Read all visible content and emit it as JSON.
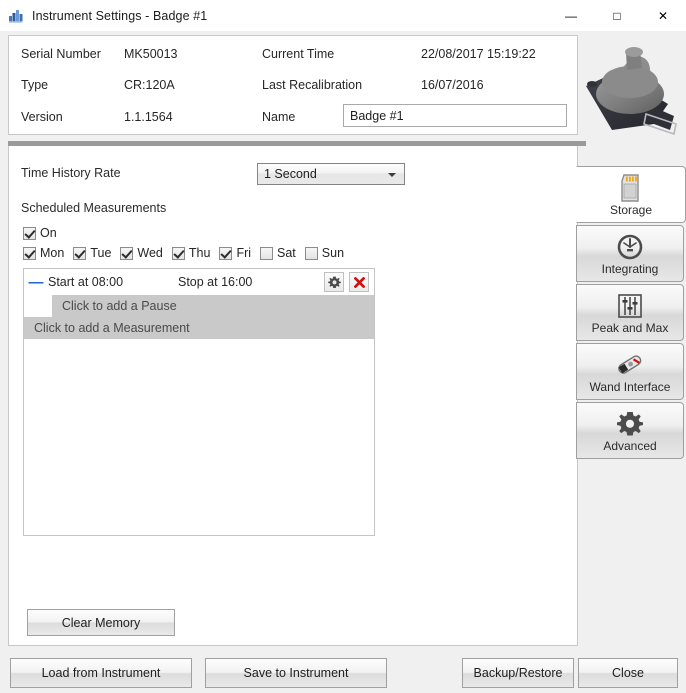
{
  "window": {
    "title": "Instrument Settings - Badge #1",
    "icon": "app-chart-icon",
    "minimize": "—",
    "maximize": "□",
    "close": "✕"
  },
  "info": {
    "serial_number_label": "Serial Number",
    "serial_number_value": "MK50013",
    "type_label": "Type",
    "type_value": "CR:120A",
    "version_label": "Version",
    "version_value": "1.1.1564",
    "current_time_label": "Current Time",
    "current_time_value": "22/08/2017 15:19:22",
    "last_recalibration_label": "Last Recalibration",
    "last_recalibration_value": "16/07/2016",
    "name_label": "Name",
    "name_value": "Badge #1",
    "name_placeholder": "Name"
  },
  "storage": {
    "time_history_rate_label": "Time History Rate",
    "time_history_rate_value": "1 Second",
    "time_history_rate_options": [
      "1 Second"
    ],
    "scheduled_measurements_label": "Scheduled Measurements",
    "on_label": "On",
    "on_checked": true,
    "days": [
      {
        "label": "Mon",
        "checked": true
      },
      {
        "label": "Tue",
        "checked": true
      },
      {
        "label": "Wed",
        "checked": true
      },
      {
        "label": "Thu",
        "checked": true
      },
      {
        "label": "Fri",
        "checked": true
      },
      {
        "label": "Sat",
        "checked": false
      },
      {
        "label": "Sun",
        "checked": false
      }
    ],
    "schedule": {
      "collapse_mark": "—",
      "start_text": "Start at 08:00",
      "stop_text": "Stop at 16:00",
      "settings_icon": "gear-icon",
      "delete_icon": "red-x-icon",
      "add_pause_text": "Click to add a Pause",
      "add_measurement_text": "Click to add a Measurement"
    },
    "clear_memory_label": "Clear Memory"
  },
  "tabs": [
    {
      "label": "Storage",
      "icon": "sd-card-icon",
      "active": true
    },
    {
      "label": "Integrating",
      "icon": "gauge-icon",
      "active": false
    },
    {
      "label": "Peak and Max",
      "icon": "sliders-icon",
      "active": false
    },
    {
      "label": "Wand Interface",
      "icon": "wand-icon",
      "active": false
    },
    {
      "label": "Advanced",
      "icon": "gear-icon",
      "active": false
    }
  ],
  "footer": {
    "load_label": "Load from Instrument",
    "save_label": "Save to Instrument",
    "backup_label": "Backup/Restore",
    "close_label": "Close"
  },
  "colors": {
    "accent_blue": "#1569c7",
    "delete_red": "#cc1111",
    "sd_contact_orange": "#f0a818",
    "panel_bg": "#ffffff",
    "window_bg": "#f0f0f0"
  }
}
